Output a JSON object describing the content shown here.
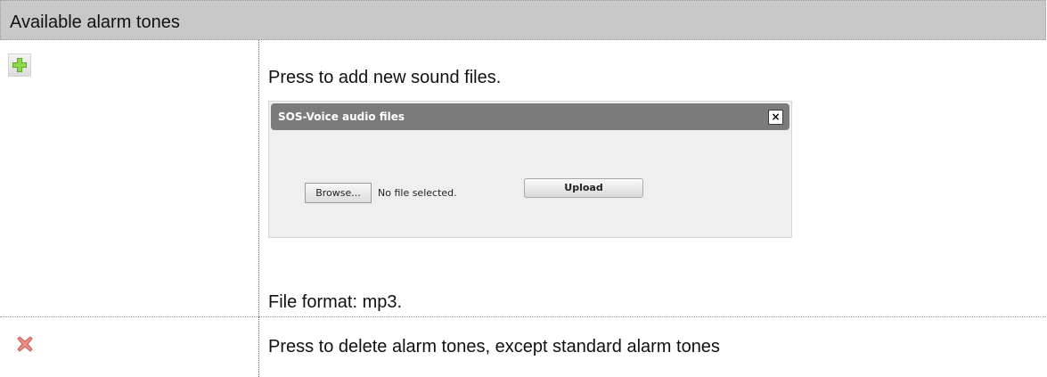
{
  "header": {
    "title": "Available alarm tones"
  },
  "rows": [
    {
      "icon": "plus-icon",
      "description": "Press to add new sound files.",
      "dialog": {
        "title": "SOS-Voice audio files",
        "close_label": "×",
        "browse_label": "Browse...",
        "no_file_text": "No file selected.",
        "upload_label": "Upload"
      },
      "format_note": "File format: mp3."
    },
    {
      "icon": "delete-icon",
      "description": "Press to delete alarm tones, except standard alarm tones"
    }
  ],
  "colors": {
    "header_bg": "#c8c8c8",
    "dialog_titlebar": "#7b7b7b",
    "plus_icon": "#7fcf3a",
    "delete_icon": "#e0706a"
  }
}
